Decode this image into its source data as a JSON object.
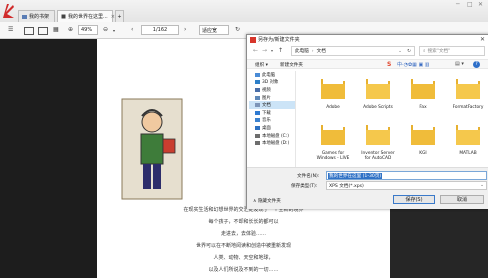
{
  "tabs": [
    {
      "label": "我的书架"
    },
    {
      "label": "我的世界在这里..."
    }
  ],
  "window_controls": {
    "min": "─",
    "max": "□",
    "close": "✕"
  },
  "toolbar": {
    "menu_icon": "hamburger-icon",
    "zoom_value": "49%",
    "page_value": "1/162",
    "fit_label": "适应宽"
  },
  "document": {
    "lines": [
      "在现实生活和幻想世界的交汇处发现了一个全新的境界",
      "每个孩子，不却和长长的都可以",
      "走进去，去体验……",
      "世界可以在不断地阅读和创造中被重新发现",
      "人类、动物、天空和地球，",
      "以及人们所说及不到的一切……"
    ]
  },
  "dialog": {
    "title": "另存为/新建文件夹",
    "close": "✕",
    "path": [
      "此电脑",
      "文档"
    ],
    "search_placeholder": "搜索\"文档\"",
    "organize_label": "组织 ▾",
    "new_folder_label": "新建文件夹",
    "sidebar": [
      {
        "label": "此电脑",
        "icon": "computer-icon",
        "color": "#4a8bd6"
      },
      {
        "label": "3D 对象",
        "icon": "cube-3d-icon",
        "color": "#2d7fc8"
      },
      {
        "label": "视频",
        "icon": "video-icon",
        "color": "#4a6ea8"
      },
      {
        "label": "图片",
        "icon": "pictures-icon",
        "color": "#5f88b8"
      },
      {
        "label": "文档",
        "icon": "document-icon",
        "color": "#7d95b8",
        "selected": true
      },
      {
        "label": "下载",
        "icon": "download-icon",
        "color": "#2f7ad1"
      },
      {
        "label": "音乐",
        "icon": "music-icon",
        "color": "#3c82cf"
      },
      {
        "label": "桌面",
        "icon": "desktop-icon",
        "color": "#2d71c2"
      },
      {
        "label": "本地磁盘 (C:)",
        "icon": "drive-icon",
        "color": "#6d6d6d"
      },
      {
        "label": "本地磁盘 (D:)",
        "icon": "drive-icon",
        "color": "#6d6d6d"
      }
    ],
    "folders": [
      {
        "name": ""
      },
      {
        "name": ""
      },
      {
        "name": ""
      },
      {
        "name": ""
      },
      {
        "name": ""
      },
      {
        "name": "Adobe"
      },
      {
        "name": "Adobe Scripts"
      },
      {
        "name": "Fax"
      },
      {
        "name": "FormatFactory"
      },
      {
        "name": "Games for Windows - LIVE"
      },
      {
        "name": "Inventor Server for AutoCAD"
      },
      {
        "name": "KGI"
      },
      {
        "name": "MATLAB"
      }
    ],
    "filename_label": "文件名(N):",
    "filename_value": "我的世界在这里 (1-30页)",
    "filetype_label": "保存类型(T):",
    "filetype_value": "XPS 文档(*.xps)",
    "hide_folders_label": "∧ 隐藏文件夹",
    "save_label": "保存(S)",
    "cancel_label": "取消"
  }
}
